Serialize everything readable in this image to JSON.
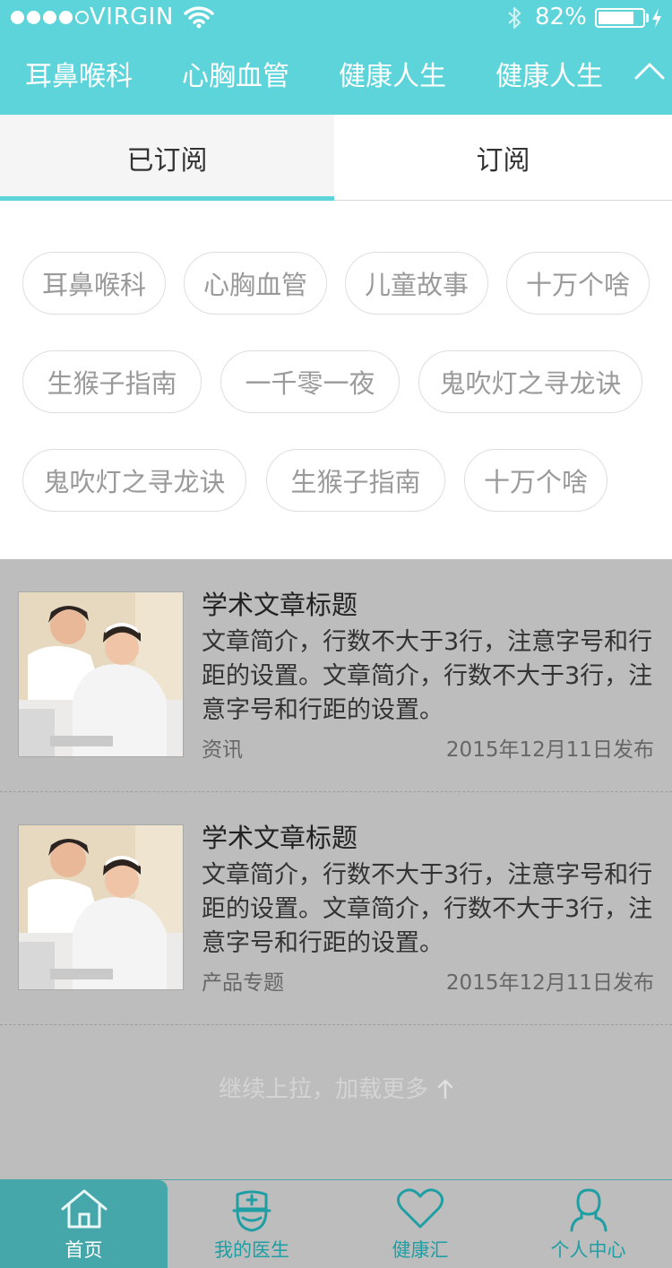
{
  "status_bar": {
    "carrier": "VIRGIN",
    "battery_percent_text": "82%",
    "battery_level": 0.82
  },
  "categories": [
    "耳鼻喉科",
    "心胸血管",
    "健康人生",
    "健康人生"
  ],
  "tabs": {
    "subscribed": "已订阅",
    "subscribe": "订阅"
  },
  "tags": [
    "耳鼻喉科",
    "心胸血管",
    "儿童故事",
    "十万个啥",
    "生猴子指南",
    "一千零一夜",
    "鬼吹灯之寻龙诀",
    "鬼吹灯之寻龙诀",
    "生猴子指南",
    "十万个啥"
  ],
  "articles": [
    {
      "title": "学术文章标题",
      "summary": "文章简介，行数不大于3行，注意字号和行距的设置。文章简介，行数不大于3行，注意字号和行距的设置。",
      "tag": "资讯",
      "date": "2015年12月11日发布"
    },
    {
      "title": "学术文章标题",
      "summary": "文章简介，行数不大于3行，注意字号和行距的设置。文章简介，行数不大于3行，注意字号和行距的设置。",
      "tag": "产品专题",
      "date": "2015年12月11日发布"
    }
  ],
  "load_more": "继续上拉，加载更多",
  "tabbar": [
    {
      "label": "首页",
      "icon": "home-icon"
    },
    {
      "label": "我的医生",
      "icon": "nurse-icon"
    },
    {
      "label": "健康汇",
      "icon": "heart-icon"
    },
    {
      "label": "个人中心",
      "icon": "person-icon"
    }
  ],
  "colors": {
    "accent": "#5cd4d9",
    "tabbar_active": "#45a7aa",
    "overlay": "#bdbdbd"
  }
}
